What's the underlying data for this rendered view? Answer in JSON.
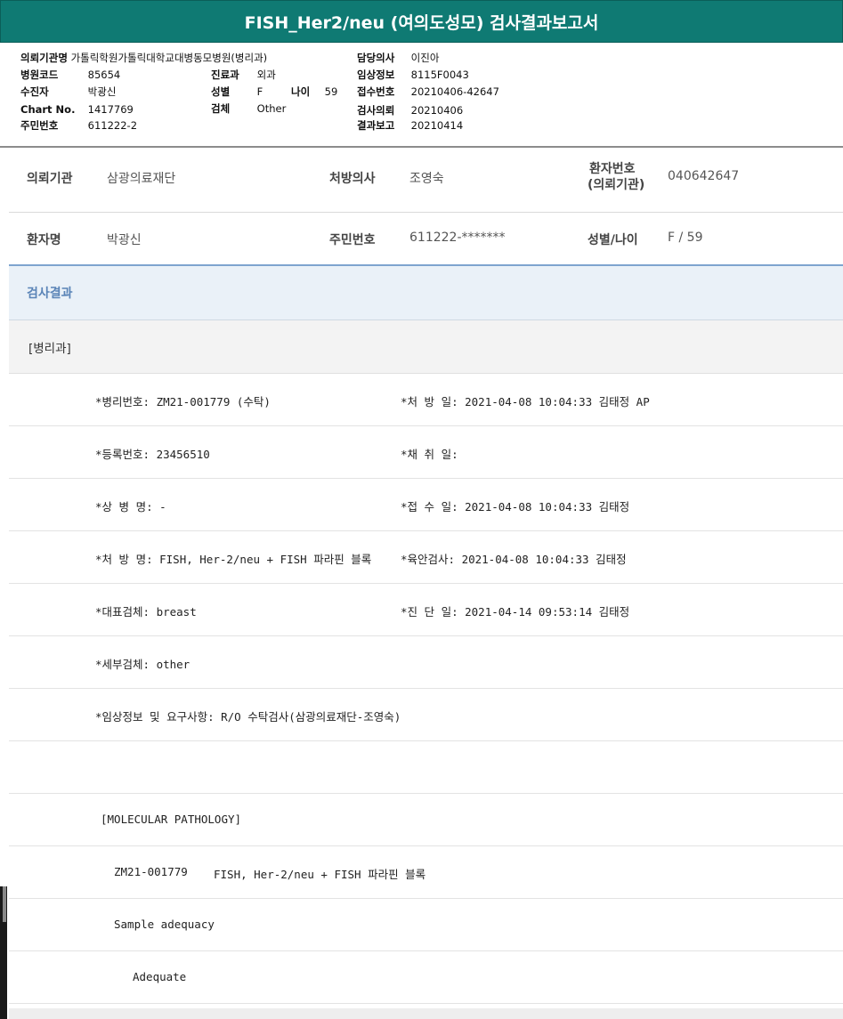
{
  "title": "FISH_Her2/neu (여의도성모) 검사결과보고서",
  "header": {
    "col1": [
      {
        "k": "의뢰기관명",
        "v": "가톨릭학원가톨릭대학교대병동모병원(병리과)"
      },
      {
        "k": "병원코드",
        "v": "85654"
      },
      {
        "k": "수진자",
        "v": "박광신"
      },
      {
        "k": "Chart No.",
        "v": "1417769"
      },
      {
        "k": "주민번호",
        "v": "611222-2"
      }
    ],
    "col2": [
      {
        "k": "진료과",
        "v": "외과"
      },
      {
        "k": "성별",
        "v": "F"
      },
      {
        "k": "검체",
        "v": "Other"
      }
    ],
    "age_k": "나이",
    "age_v": "59",
    "col3": [
      {
        "k": "담당의사",
        "v": "이진아"
      },
      {
        "k": "임상정보",
        "v": "8115F0043"
      },
      {
        "k": "접수번호",
        "v": "20210406-42647"
      },
      {
        "k": "검사의뢰",
        "v": "20210406"
      },
      {
        "k": "결과보고",
        "v": "20210414"
      }
    ]
  },
  "info": {
    "row1": {
      "k1": "의뢰기관",
      "v1": "삼광의료재단",
      "k2": "처방의사",
      "v2": "조영숙",
      "k3a": "환자번호",
      "k3b": "(의뢰기관)",
      "v3": "040642647"
    },
    "row2": {
      "k1": "환자명",
      "v1": "박광신",
      "k2": "주민번호",
      "v2": "611222-*******",
      "k3": "성별/나이",
      "v3": "F / 59"
    }
  },
  "results_title": "검사결과",
  "dept": "[병리과]",
  "rows": [
    {
      "left": "*병리번호: ZM21-001779 (수탁)",
      "right": "*처 방 일: 2021-04-08 10:04:33  김태정 AP"
    },
    {
      "left": "*등록번호: 23456510",
      "right": "*채 취 일:"
    },
    {
      "left": "*상 병 명: -",
      "right": "*접 수 일: 2021-04-08 10:04:33  김태정"
    },
    {
      "left": "*처 방 명: FISH, Her-2/neu + FISH 파라핀 블록",
      "right": "*육안검사: 2021-04-08 10:04:33  김태정"
    },
    {
      "left": "*대표검체: breast",
      "right": "*진 단 일: 2021-04-14 09:53:14  김태정"
    },
    {
      "left": "*세부검체: other",
      "right": ""
    },
    {
      "left": "*임상정보 및 요구사항: R/O 수탁검사(삼광의료재단-조영숙)",
      "right": ""
    }
  ],
  "molecular": {
    "heading": "[MOLECULAR PATHOLOGY]",
    "code": "ZM21-001779",
    "test": "FISH, Her-2/neu + FISH 파라핀 블록",
    "sample_label": "Sample adequacy",
    "sample_value": "Adequate"
  }
}
